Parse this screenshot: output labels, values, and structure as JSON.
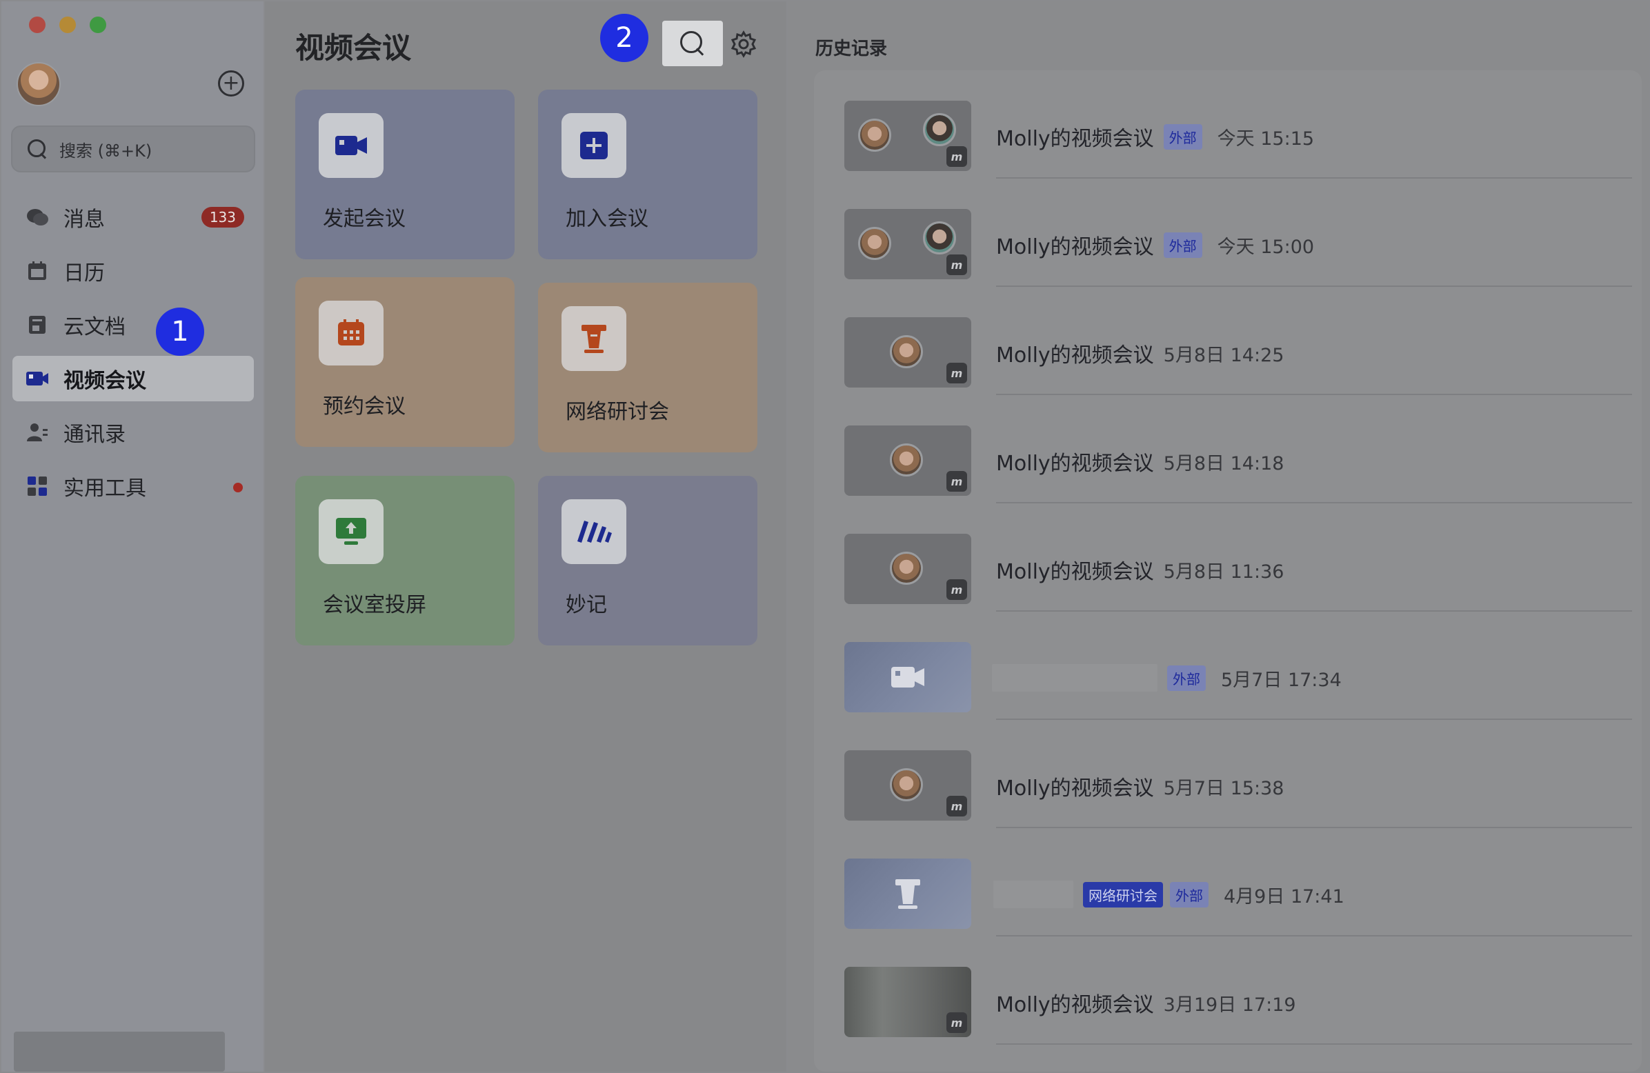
{
  "sidebar": {
    "search_placeholder": "搜索 (⌘+K)",
    "items": [
      {
        "label": "消息",
        "icon": "chat-bubble-icon",
        "badge": "133"
      },
      {
        "label": "日历",
        "icon": "calendar-icon"
      },
      {
        "label": "云文档",
        "icon": "document-icon"
      },
      {
        "label": "视频会议",
        "icon": "video-camera-icon",
        "active": true
      },
      {
        "label": "通讯录",
        "icon": "contacts-icon"
      },
      {
        "label": "实用工具",
        "icon": "apps-grid-icon",
        "dot": true
      }
    ]
  },
  "markers": {
    "one": "1",
    "two": "2"
  },
  "main": {
    "title": "视频会议",
    "tiles": [
      {
        "label": "发起会议",
        "icon": "video-camera-icon"
      },
      {
        "label": "加入会议",
        "icon": "plus-square-icon"
      },
      {
        "label": "预约会议",
        "icon": "calendar-schedule-icon"
      },
      {
        "label": "网络研讨会",
        "icon": "podium-icon"
      },
      {
        "label": "会议室投屏",
        "icon": "screen-share-icon"
      },
      {
        "label": "妙记",
        "icon": "minutes-icon"
      }
    ]
  },
  "history": {
    "title": "历史记录",
    "rows": [
      {
        "name": "Molly的视频会议",
        "tags": [
          "外部"
        ],
        "time": "今天 15:15"
      },
      {
        "name": "Molly的视频会议",
        "tags": [
          "外部"
        ],
        "time": "今天 15:00"
      },
      {
        "name": "Molly的视频会议",
        "tags": [],
        "time": "5月8日 14:25"
      },
      {
        "name": "Molly的视频会议",
        "tags": [],
        "time": "5月8日 14:18"
      },
      {
        "name": "Molly的视频会议",
        "tags": [],
        "time": "5月8日 11:36"
      },
      {
        "name": "",
        "tags": [
          "外部"
        ],
        "time": "5月7日 17:34"
      },
      {
        "name": "Molly的视频会议",
        "tags": [],
        "time": "5月7日 15:38"
      },
      {
        "name": "",
        "tags": [
          "网络研讨会",
          "外部"
        ],
        "time": "4月9日 17:41"
      },
      {
        "name": "Molly的视频会议",
        "tags": [],
        "time": "3月19日 17:19"
      }
    ]
  },
  "colors": {
    "accent": "#1f2de0",
    "badge": "#8e2a25"
  }
}
